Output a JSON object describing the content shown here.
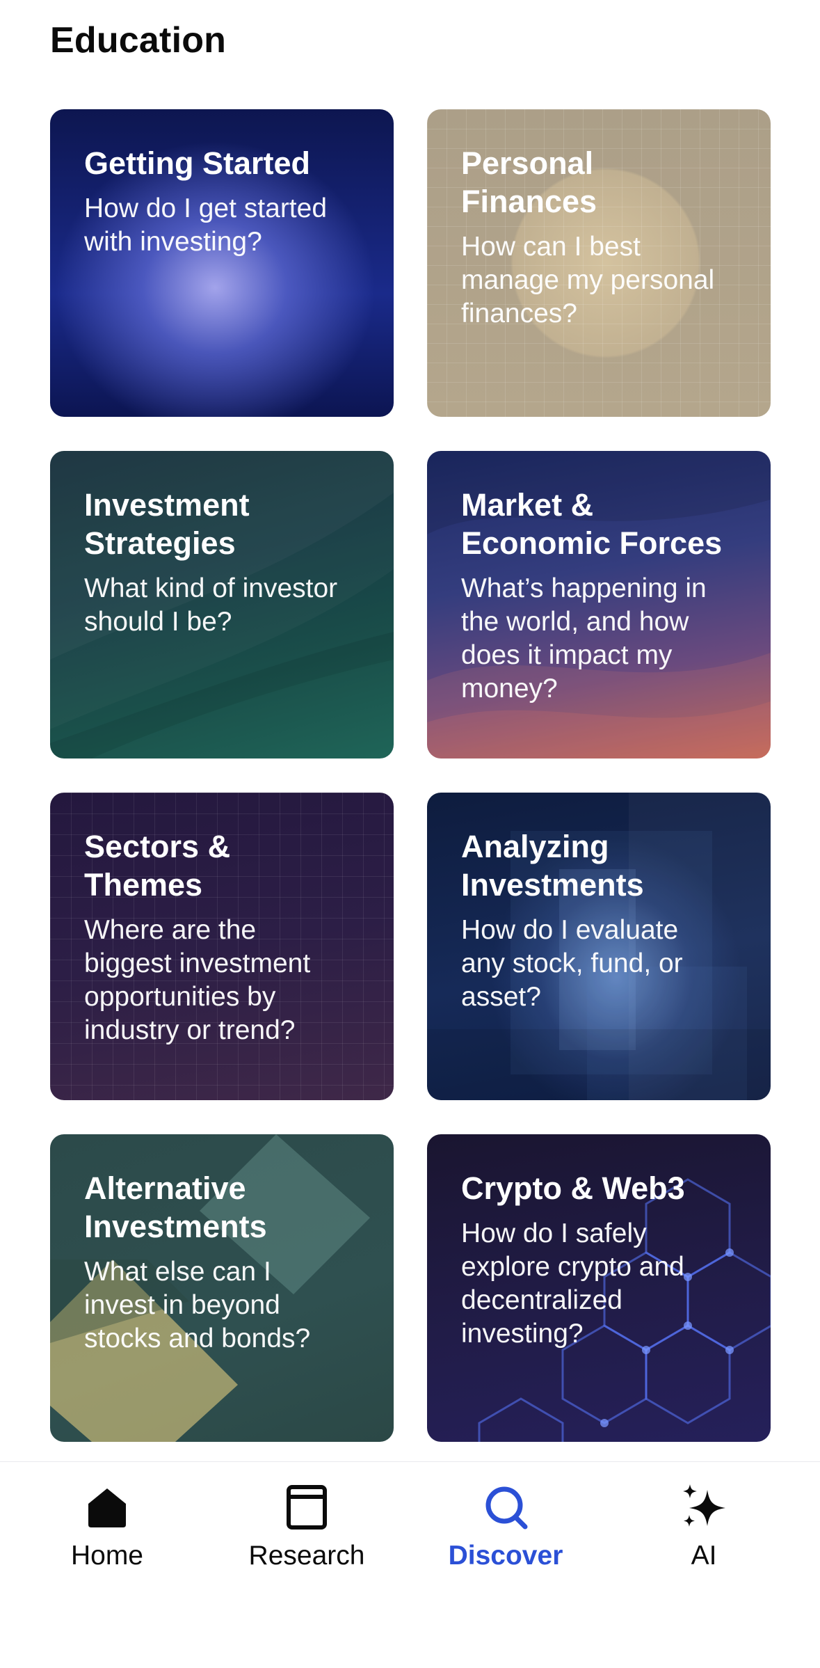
{
  "section": {
    "title": "Education"
  },
  "cards": [
    {
      "title": "Getting Started",
      "description": "How do I get started\nwith investing?"
    },
    {
      "title": "Personal\nFinances",
      "description": "How can I best\nmanage my personal\nfinances?"
    },
    {
      "title": "Investment\nStrategies",
      "description": "What kind of investor\nshould I be?"
    },
    {
      "title": "Market &\nEconomic Forces",
      "description": "What’s happening in\nthe world, and how\ndoes it impact my\nmoney?"
    },
    {
      "title": "Sectors &\nThemes",
      "description": "Where are the\nbiggest investment\nopportunities by\nindustry or trend?"
    },
    {
      "title": "Analyzing\nInvestments",
      "description": "How do I evaluate\nany stock, fund, or\nasset?"
    },
    {
      "title": "Alternative\nInvestments",
      "description": "What else can I\ninvest in beyond\nstocks and bonds?"
    },
    {
      "title": "Crypto & Web3",
      "description": "How do I safely\nexplore crypto and\ndecentralized\ninvesting?"
    }
  ],
  "tabbar": {
    "active": "Discover",
    "accent_color": "#2b50d6",
    "tabs": [
      {
        "label": "Home",
        "icon": "home-icon"
      },
      {
        "label": "Research",
        "icon": "book-icon"
      },
      {
        "label": "Discover",
        "icon": "search-icon"
      },
      {
        "label": "AI",
        "icon": "sparkle-icon"
      }
    ]
  }
}
